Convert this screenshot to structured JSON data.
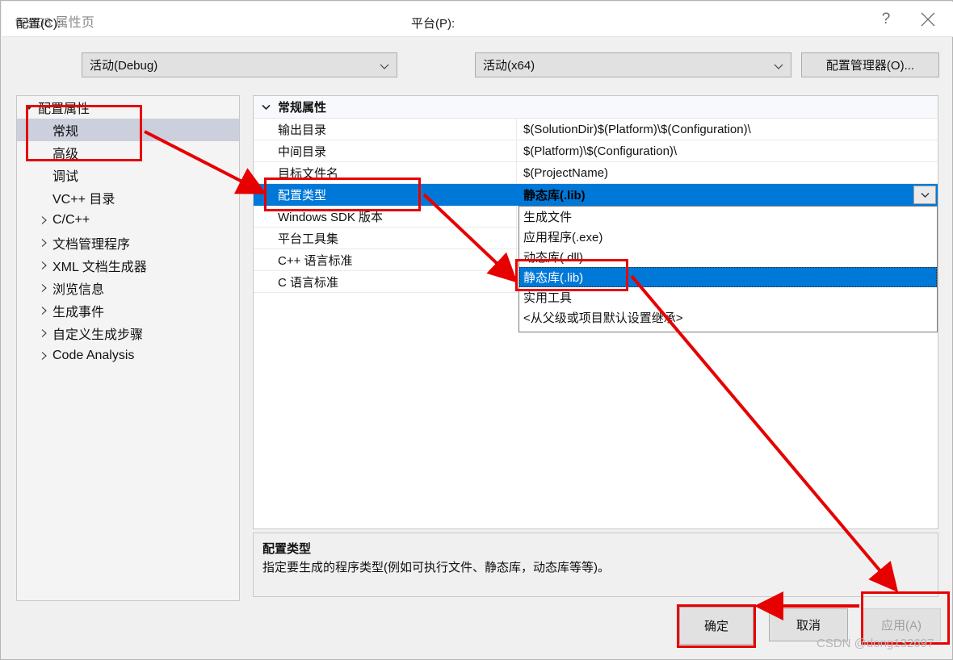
{
  "window": {
    "title": "test08 属性页",
    "help_icon": "question-mark-icon",
    "close_icon": "close-icon"
  },
  "toolbar": {
    "config_label": "配置(C):",
    "config_value": "活动(Debug)",
    "platform_label": "平台(P):",
    "platform_value": "活动(x64)",
    "config_manager_label": "配置管理器(O)..."
  },
  "tree": {
    "items": [
      {
        "label": "配置属性",
        "level": 1,
        "twisty": "expanded",
        "selected": false
      },
      {
        "label": "常规",
        "level": 2,
        "twisty": "none",
        "selected": true
      },
      {
        "label": "高级",
        "level": 2,
        "twisty": "none",
        "selected": false
      },
      {
        "label": "调试",
        "level": 2,
        "twisty": "none",
        "selected": false
      },
      {
        "label": "VC++ 目录",
        "level": 2,
        "twisty": "none",
        "selected": false
      },
      {
        "label": "C/C++",
        "level": 2,
        "twisty": "collapsed",
        "selected": false
      },
      {
        "label": "文档管理程序",
        "level": 2,
        "twisty": "collapsed",
        "selected": false
      },
      {
        "label": "XML 文档生成器",
        "level": 2,
        "twisty": "collapsed",
        "selected": false
      },
      {
        "label": "浏览信息",
        "level": 2,
        "twisty": "collapsed",
        "selected": false
      },
      {
        "label": "生成事件",
        "level": 2,
        "twisty": "collapsed",
        "selected": false
      },
      {
        "label": "自定义生成步骤",
        "level": 2,
        "twisty": "collapsed",
        "selected": false
      },
      {
        "label": "Code Analysis",
        "level": 2,
        "twisty": "collapsed",
        "selected": false
      }
    ]
  },
  "grid": {
    "section_header": "常规属性",
    "section_chevron": "chevron-down-icon",
    "rows": [
      {
        "name": "输出目录",
        "value": "$(SolutionDir)$(Platform)\\$(Configuration)\\",
        "selected": false
      },
      {
        "name": "中间目录",
        "value": "$(Platform)\\$(Configuration)\\",
        "selected": false
      },
      {
        "name": "目标文件名",
        "value": "$(ProjectName)",
        "selected": false
      },
      {
        "name": "配置类型",
        "value": "静态库(.lib)",
        "selected": true
      },
      {
        "name": "Windows SDK 版本",
        "value": "",
        "selected": false
      },
      {
        "name": "平台工具集",
        "value": "",
        "selected": false
      },
      {
        "name": "C++ 语言标准",
        "value": "",
        "selected": false
      },
      {
        "name": "C 语言标准",
        "value": "",
        "selected": false
      }
    ]
  },
  "dropdown": {
    "open": true,
    "options": [
      {
        "label": "生成文件",
        "selected": false
      },
      {
        "label": "应用程序(.exe)",
        "selected": false
      },
      {
        "label": "动态库(.dll)",
        "selected": false
      },
      {
        "label": "静态库(.lib)",
        "selected": true
      },
      {
        "label": "实用工具",
        "selected": false
      },
      {
        "label": "<从父级或项目默认设置继承>",
        "selected": false
      }
    ]
  },
  "description": {
    "title": "配置类型",
    "body": "指定要生成的程序类型(例如可执行文件、静态库，动态库等等)。"
  },
  "footer": {
    "ok_label": "确定",
    "cancel_label": "取消",
    "apply_label": "应用(A)",
    "apply_disabled": true
  },
  "watermark": {
    "text": "CSDN @dong132697"
  },
  "colors": {
    "selection_blue": "#0078d7",
    "tree_selection": "#ccd0dc",
    "annotation_red": "#e60000",
    "dialog_bg": "#f0f0f0"
  }
}
